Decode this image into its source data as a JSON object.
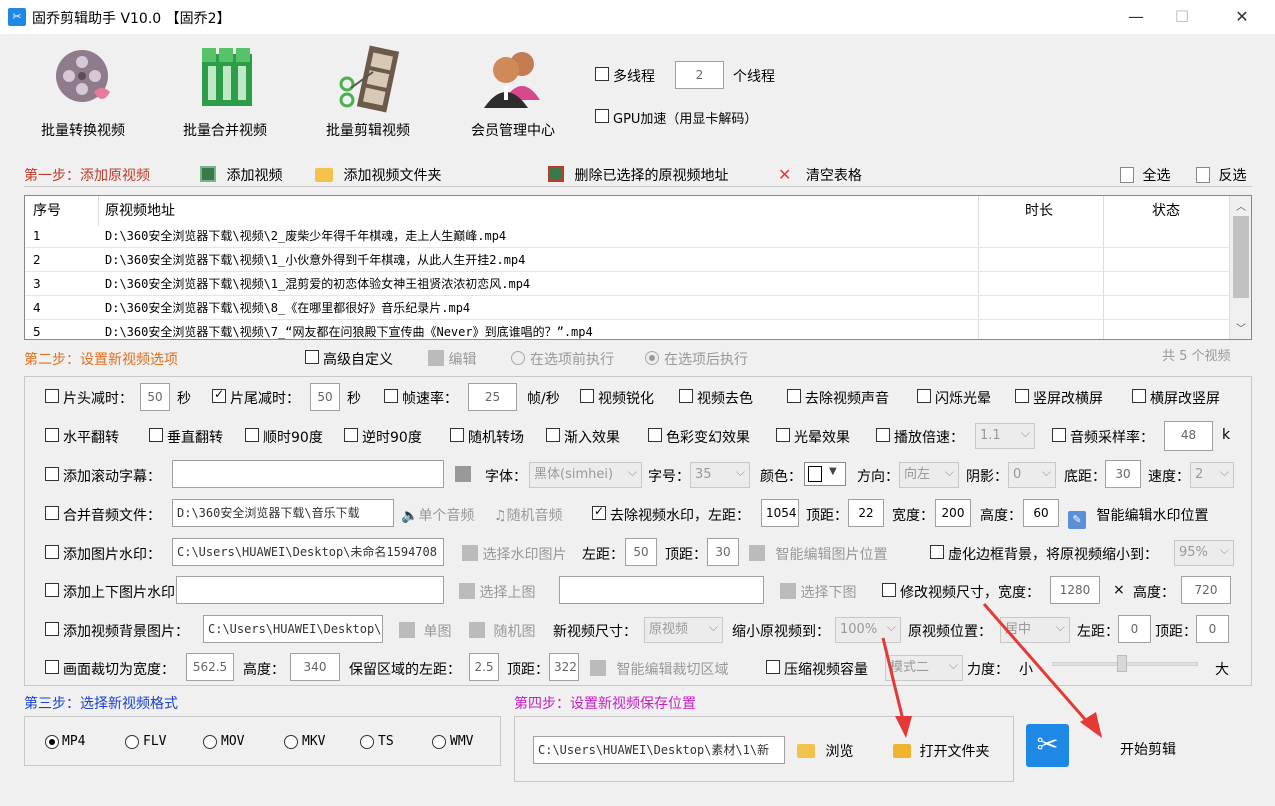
{
  "window": {
    "title": "固乔剪辑助手 V10.0 【固乔2】",
    "minimize": "—",
    "maximize": "☐",
    "close": "✕"
  },
  "toolbar": {
    "convert": "批量转换视频",
    "merge": "批量合并视频",
    "edit": "批量剪辑视频",
    "member": "会员管理中心",
    "multithread_label": "多线程",
    "thread_count": "2",
    "thread_unit": "个线程",
    "gpu_label": "GPU加速（用显卡解码）"
  },
  "step1": {
    "title": "第一步：添加原视频",
    "add_video": "添加视频",
    "add_folder": "添加视频文件夹",
    "delete_selected": "删除已选择的原视频地址",
    "clear_table": "清空表格",
    "select_all": "全选",
    "invert": "反选"
  },
  "table": {
    "headers": [
      "序号",
      "原视频地址",
      "时长",
      "状态"
    ],
    "rows": [
      {
        "idx": "1",
        "path": "D:\\360安全浏览器下载\\视频\\2_废柴少年得千年棋魂，走上人生巅峰.mp4"
      },
      {
        "idx": "2",
        "path": "D:\\360安全浏览器下载\\视频\\1_小伙意外得到千年棋魂，从此人生开挂2.mp4"
      },
      {
        "idx": "3",
        "path": "D:\\360安全浏览器下载\\视频\\1_混剪爱的初恋体验女神王祖贤浓浓初恋风.mp4"
      },
      {
        "idx": "4",
        "path": "D:\\360安全浏览器下载\\视频\\8_《在哪里都很好》音乐纪录片.mp4"
      },
      {
        "idx": "5",
        "path": "D:\\360安全浏览器下载\\视频\\7_“网友都在问狼殿下宣传曲《Never》到底谁唱的？”.mp4"
      }
    ]
  },
  "step2": {
    "title": "第二步：设置新视频选项",
    "advanced": "高级自定义",
    "edit": "编辑",
    "before": "在选项前执行",
    "after": "在选项后执行",
    "count": "共 5 个视频"
  },
  "opts": {
    "head_cut": "片头减时：",
    "head_val": "50",
    "sec1": "秒",
    "tail_cut": "片尾减时：",
    "tail_val": "50",
    "sec2": "秒",
    "framerate": "帧速率：",
    "framerate_val": "25",
    "fps_unit": "帧/秒",
    "sharpen": "视频锐化",
    "decolor": "视频去色",
    "remove_audio": "去除视频声音",
    "flash": "闪烁光晕",
    "v2h": "竖屏改横屏",
    "h2v": "横屏改竖屏",
    "hflip": "水平翻转",
    "vflip": "垂直翻转",
    "cw90": "顺时90度",
    "ccw90": "逆时90度",
    "random_trans": "随机转场",
    "fade": "渐入效果",
    "color_fx": "色彩变幻效果",
    "halo": "光晕效果",
    "speed": "播放倍速：",
    "speed_val": "1.1",
    "sample": "音频采样率：",
    "sample_val": "48",
    "sample_unit": "k",
    "subtitle": "添加滚动字幕：",
    "font": "字体：",
    "font_val": "黑体(simhei)",
    "size": "字号：",
    "size_val": "35",
    "color": "颜色：",
    "direction": "方向：",
    "direction_val": "向左",
    "shadow": "阴影：",
    "shadow_val": "0",
    "bottom": "底距：",
    "bottom_val": "30",
    "speed2": "速度：",
    "speed2_val": "2",
    "merge_audio": "合并音频文件：",
    "audio_path": "D:\\360安全浏览器下载\\音乐下载",
    "single_audio": "单个音频",
    "random_audio": "随机音频",
    "remove_wm": "去除视频水印，左距：",
    "wm_left": "1054",
    "top_lbl": "顶距：",
    "wm_top": "22",
    "width_lbl": "宽度：",
    "wm_w": "200",
    "height_lbl": "高度：",
    "wm_h": "60",
    "smart_wm": "智能编辑水印位置",
    "img_wm": "添加图片水印：",
    "img_wm_path": "C:\\Users\\HUAWEI\\Desktop\\未命名1594708",
    "choose_wm": "选择水印图片",
    "left_lbl": "左距：",
    "img_left": "50",
    "img_top": "30",
    "smart_img": "智能编辑图片位置",
    "blur_bg": "虚化边框背景，将原视频缩小到：",
    "blur_val": "95%",
    "tb_wm": "添加上下图片水印：",
    "choose_top": "选择上图",
    "choose_bottom": "选择下图",
    "resize": "修改视频尺寸，宽度：",
    "resize_w": "1280",
    "times": "×",
    "resize_h_lbl": "高度：",
    "resize_h": "720",
    "bg_img": "添加视频背景图片：",
    "bg_path": "C:\\Users\\HUAWEI\\Desktop\\",
    "single_img": "单图",
    "random_img": "随机图",
    "new_size": "新视频尺寸：",
    "new_size_val": "原视频",
    "shrink": "缩小原视频到：",
    "shrink_val": "100%",
    "pos": "原视频位置：",
    "pos_val": "居中",
    "bg_left": "0",
    "bg_top": "0",
    "crop": "画面裁切为宽度：",
    "crop_w": "562.5",
    "crop_h_lbl": "高度：",
    "crop_h": "340",
    "keep_left": "保留区域的左距：",
    "keep_left_val": "2.5",
    "keep_top_val": "322.",
    "smart_crop": "智能编辑裁切区域",
    "compress": "压缩视频容量",
    "compress_val": "模式二",
    "force": "力度：",
    "small": "小",
    "big": "大"
  },
  "step3": {
    "title": "第三步：选择新视频格式",
    "formats": [
      "MP4",
      "FLV",
      "MOV",
      "MKV",
      "TS",
      "WMV"
    ]
  },
  "step4": {
    "title": "第四步：设置新视频保存位置",
    "path": "C:\\Users\\HUAWEI\\Desktop\\素材\\1\\新",
    "browse": "浏览",
    "open_folder": "打开文件夹",
    "start": "开始剪辑"
  },
  "colors": {
    "accent_blue": "#1e88e5",
    "arrow_red": "#e53935",
    "step_red": "#c0392b"
  }
}
